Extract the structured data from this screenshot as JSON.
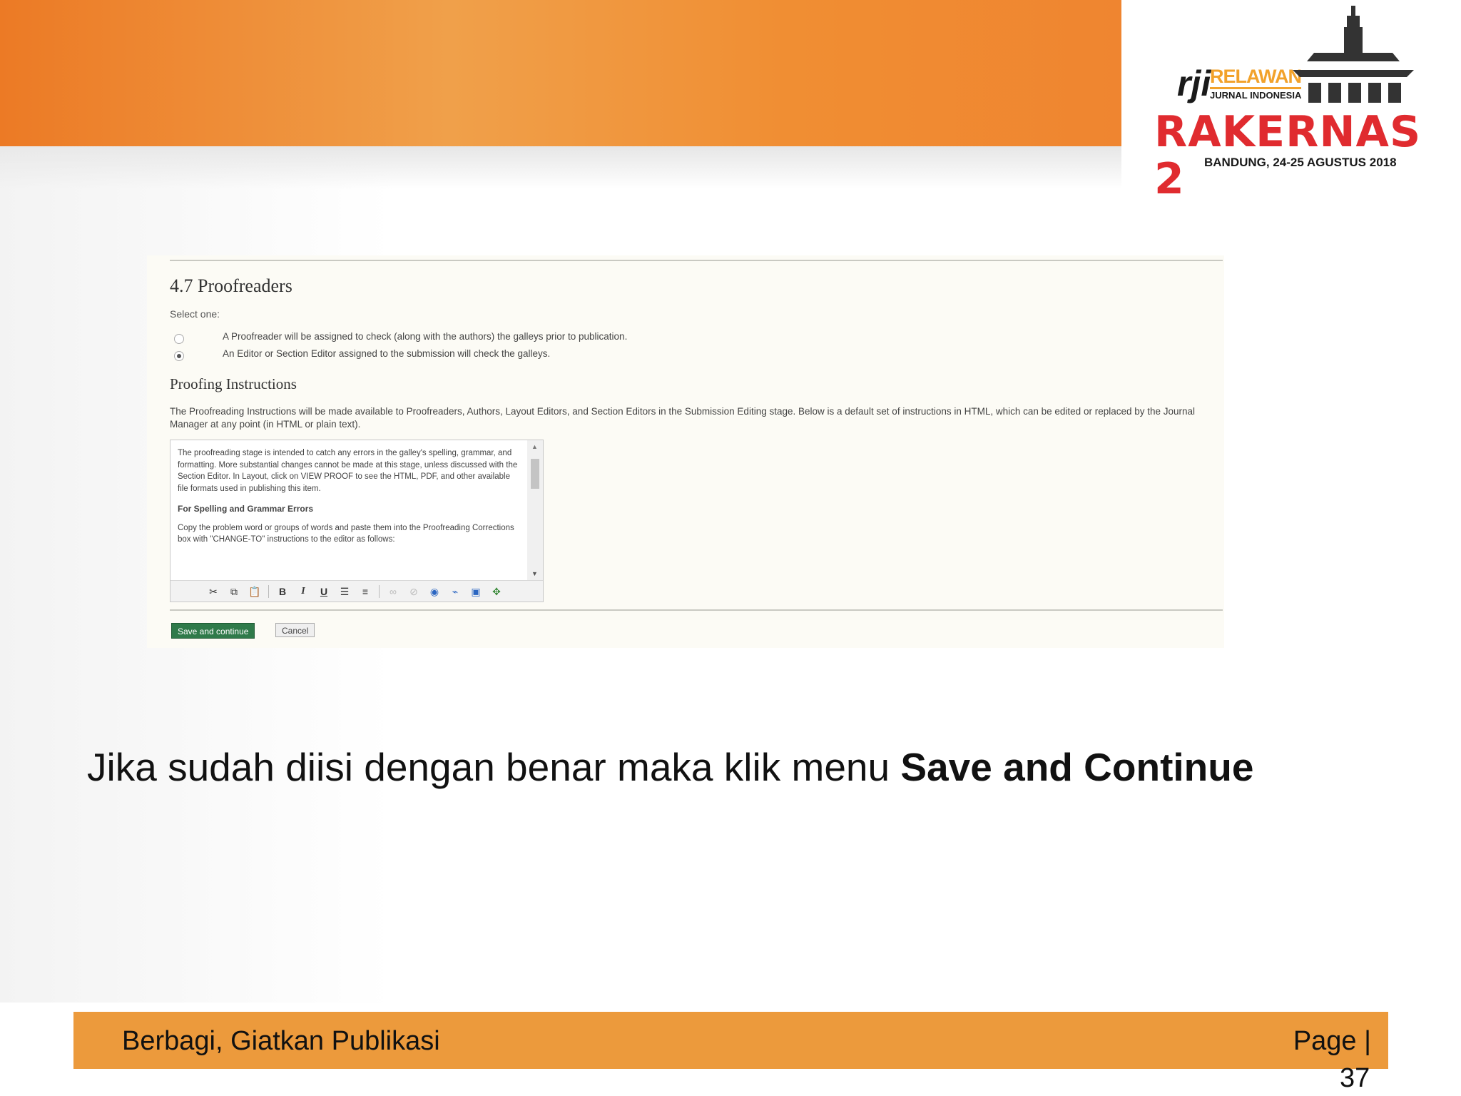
{
  "logo": {
    "mark": "rji",
    "relawan": "RELAWAN",
    "jurnal": "JURNAL INDONESIA",
    "title": "RAKERNAS 2",
    "subtitle": "BANDUNG, 24-25 AGUSTUS 2018"
  },
  "form": {
    "section_title": "4.7 Proofreaders",
    "select_label": "Select one:",
    "options": [
      {
        "label": "A Proofreader will be assigned to check (along with the authors) the galleys prior to publication.",
        "selected": false
      },
      {
        "label": "An Editor or Section Editor assigned to the submission will check the galleys.",
        "selected": true
      }
    ],
    "instructions_title": "Proofing Instructions",
    "instructions_desc": "The Proofreading Instructions will be made available to Proofreaders, Authors, Layout Editors, and Section Editors in the Submission Editing stage. Below is a default set of instructions in HTML, which can be edited or replaced by the Journal Manager at any point (in HTML or plain text).",
    "editor": {
      "paragraph_1": "The proofreading stage is intended to catch any errors in the galley's spelling, grammar, and formatting. More substantial changes cannot be made at this stage, unless discussed with the Section Editor. In Layout, click on VIEW PROOF to see the HTML, PDF, and other available file formats used in publishing this item.",
      "heading": "For Spelling and Grammar Errors",
      "paragraph_2": "Copy the problem word or groups of words and paste them into the Proofreading Corrections box with \"CHANGE-TO\" instructions to the editor as follows:"
    },
    "save_label": "Save and continue",
    "cancel_label": "Cancel"
  },
  "caption": {
    "text": "Jika sudah diisi dengan benar maka klik menu ",
    "bold": "Save and Continue"
  },
  "footer": {
    "text": "Berbagi, Giatkan Publikasi",
    "page_label": "Page |",
    "page_number": "37"
  },
  "colors": {
    "banner": "#ec7a25",
    "footer": "#ec9a3c",
    "rakernas_red": "#e02b2f",
    "rji_yellow": "#f2a22b",
    "save_green": "#2f7a4a"
  },
  "icons": [
    "cut-icon",
    "copy-icon",
    "paste-icon",
    "bold-icon",
    "italic-icon",
    "underline-icon",
    "bullet-list-icon",
    "numbered-list-icon",
    "link-icon",
    "unlink-icon",
    "help-icon",
    "html-icon",
    "image-icon",
    "fullscreen-icon"
  ]
}
